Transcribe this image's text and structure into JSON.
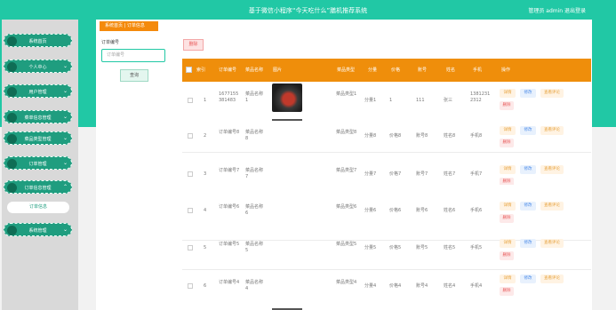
{
  "header": {
    "title": "基于微信小程序“今天吃什么”膳机推荐系统",
    "user_text": "管理员 admin  退出登录"
  },
  "sidebar": {
    "items": [
      {
        "label": "系统首页",
        "chevron": ""
      },
      {
        "label": "个人中心",
        "chevron": "⌄"
      },
      {
        "label": "用户管理",
        "chevron": "⌄"
      },
      {
        "label": "菜单信息管理",
        "chevron": "⌄"
      },
      {
        "label": "菜品类型管理",
        "chevron": "⌄"
      },
      {
        "label": "订单管理",
        "chevron": "⌄"
      },
      {
        "label": "订单信息管理",
        "chevron": "⌃"
      },
      {
        "label": "系统管理",
        "chevron": "⌄"
      }
    ],
    "sub_item": "订单信息"
  },
  "breadcrumb": "系统首页  |  订单信息",
  "search": {
    "label": "订单编号",
    "placeholder": "订单编号",
    "button": "查询"
  },
  "delete_button": "删除",
  "table": {
    "columns": [
      "",
      "索引",
      "订单编号",
      "菜品名称",
      "图片",
      "菜品类型",
      "分量",
      "价格",
      "账号",
      "姓名",
      "手机",
      "操作"
    ],
    "actions": {
      "detail": "详情",
      "edit": "修改",
      "review": "查看评论",
      "delete": "删除"
    },
    "rows": [
      {
        "index": "1",
        "order_no": "1677155381483",
        "dish": "菜品名称1",
        "has_image": true,
        "type": "菜品类型1",
        "portion": "分量1",
        "price": "1",
        "account": "111",
        "name": "张三",
        "phone": "13812312312"
      },
      {
        "index": "2",
        "order_no": "订单编号8",
        "dish": "菜品名称8",
        "has_image": false,
        "type": "菜品类型8",
        "portion": "分量8",
        "price": "价格8",
        "account": "账号8",
        "name": "姓名8",
        "phone": "手机8"
      },
      {
        "index": "3",
        "order_no": "订单编号7",
        "dish": "菜品名称7",
        "has_image": false,
        "type": "菜品类型7",
        "portion": "分量7",
        "price": "价格7",
        "account": "账号7",
        "name": "姓名7",
        "phone": "手机7"
      },
      {
        "index": "4",
        "order_no": "订单编号6",
        "dish": "菜品名称6",
        "has_image": false,
        "type": "菜品类型6",
        "portion": "分量6",
        "price": "价格6",
        "account": "账号6",
        "name": "姓名6",
        "phone": "手机6"
      },
      {
        "index": "5",
        "order_no": "订单编号5",
        "dish": "菜品名称5",
        "has_image": false,
        "type": "菜品类型5",
        "portion": "分量5",
        "price": "价格5",
        "account": "账号5",
        "name": "姓名5",
        "phone": "手机5"
      },
      {
        "index": "6",
        "order_no": "订单编号4",
        "dish": "菜品名称4",
        "has_image": false,
        "type": "菜品类型4",
        "portion": "分量4",
        "price": "价格4",
        "account": "账号4",
        "name": "姓名4",
        "phone": "手机4"
      }
    ]
  },
  "colors": {
    "accent": "#21c8a5",
    "table_header": "#ef8e0b",
    "breadcrumb": "#f48a0c"
  }
}
